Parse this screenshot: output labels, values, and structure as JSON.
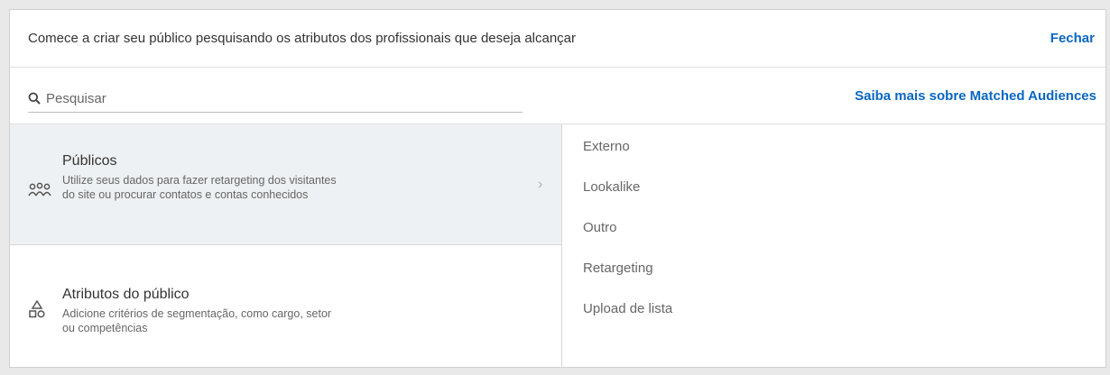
{
  "header": {
    "text": "Comece a criar seu público pesquisando os atributos dos profissionais que deseja alcançar",
    "close_label": "Fechar"
  },
  "search": {
    "placeholder": "Pesquisar",
    "icon": "search-icon"
  },
  "learn_more": "Saiba mais sobre Matched Audiences",
  "categories": [
    {
      "title": "Públicos",
      "description": "Utilize seus dados para fazer retargeting dos visitantes do site ou procurar contatos e contas conhecidos",
      "icon": "people-group-icon",
      "active": true
    },
    {
      "title": "Atributos do público",
      "description": "Adicione critérios de segmentação, como cargo, setor ou competências",
      "icon": "shapes-icon",
      "active": false
    }
  ],
  "subitems": [
    "Externo",
    "Lookalike",
    "Outro",
    "Retargeting",
    "Upload de lista"
  ],
  "colors": {
    "link": "#0a66c2",
    "active_bg": "#eef1f3"
  }
}
